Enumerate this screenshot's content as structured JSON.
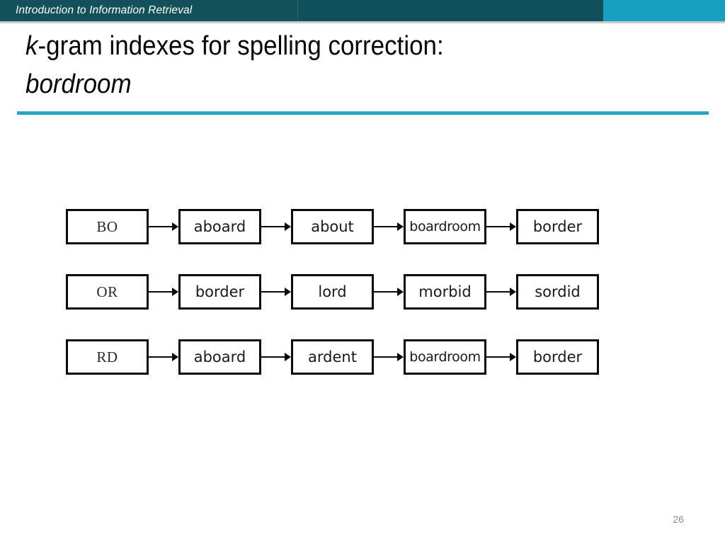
{
  "header": {
    "course_title": "Introduction to Information Retrieval",
    "band_color": "#12515a",
    "accent_color": "#169fc0"
  },
  "title": {
    "line1_italic_prefix": "k",
    "line1_rest": "-gram indexes for spelling correction:",
    "line2": "bordroom",
    "rule_color": "#26a3bd"
  },
  "diagram": {
    "type": "kgram-postings-lists",
    "rows": [
      {
        "gram": "BO",
        "terms": [
          "aboard",
          "about",
          "boardroom",
          "border"
        ]
      },
      {
        "gram": "OR",
        "terms": [
          "border",
          "lord",
          "morbid",
          "sordid"
        ]
      },
      {
        "gram": "RD",
        "terms": [
          "aboard",
          "ardent",
          "boardroom",
          "border"
        ]
      }
    ]
  },
  "footer": {
    "page_number": "26"
  }
}
